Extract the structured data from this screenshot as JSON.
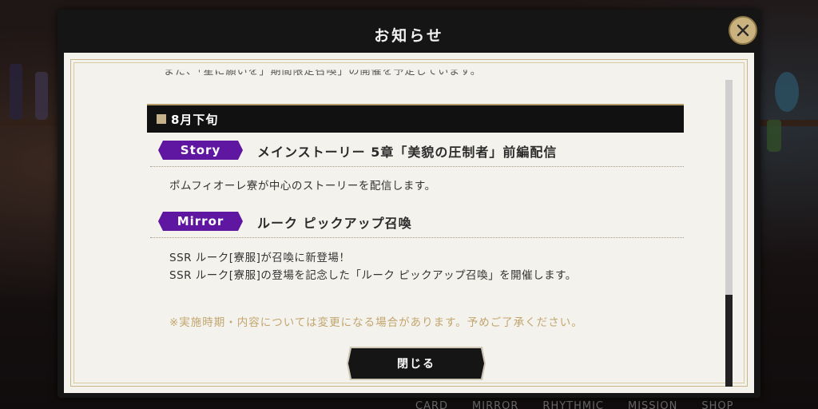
{
  "dialog": {
    "title": "お知らせ",
    "close_icon": "close-x-icon",
    "close_button_label": "閉じる"
  },
  "content": {
    "cut_off_line": "また、「星に願いを」期間限定召喚」の開催を予定しています。",
    "section_title": "8月下旬",
    "entries": [
      {
        "tag": "Story",
        "title": "メインストーリー 5章「美貌の圧制者」前編配信",
        "lines": [
          "ポムフィオーレ寮が中心のストーリーを配信します。"
        ]
      },
      {
        "tag": "Mirror",
        "title": "ルーク ピックアップ召喚",
        "lines": [
          "SSR ルーク[寮服]が召喚に新登場！",
          "SSR ルーク[寮服]の登場を記念した「ルーク ピックアップ召喚」を開催します。"
        ]
      }
    ],
    "note": "※実施時期・内容については変更になる場合があります。予めご了承ください。"
  },
  "scrollbar": {
    "thumb_fraction": 0.3,
    "thumb_position": 0.7
  },
  "background_nav": [
    "CARD",
    "MIRROR",
    "RHYTHMIC",
    "MISSION",
    "SHOP"
  ],
  "colors": {
    "tag_purple": "#5f16a0",
    "note_gold": "#c2a56f",
    "accent_gold": "#c9b27e",
    "panel_bg": "#f4f2ec"
  }
}
